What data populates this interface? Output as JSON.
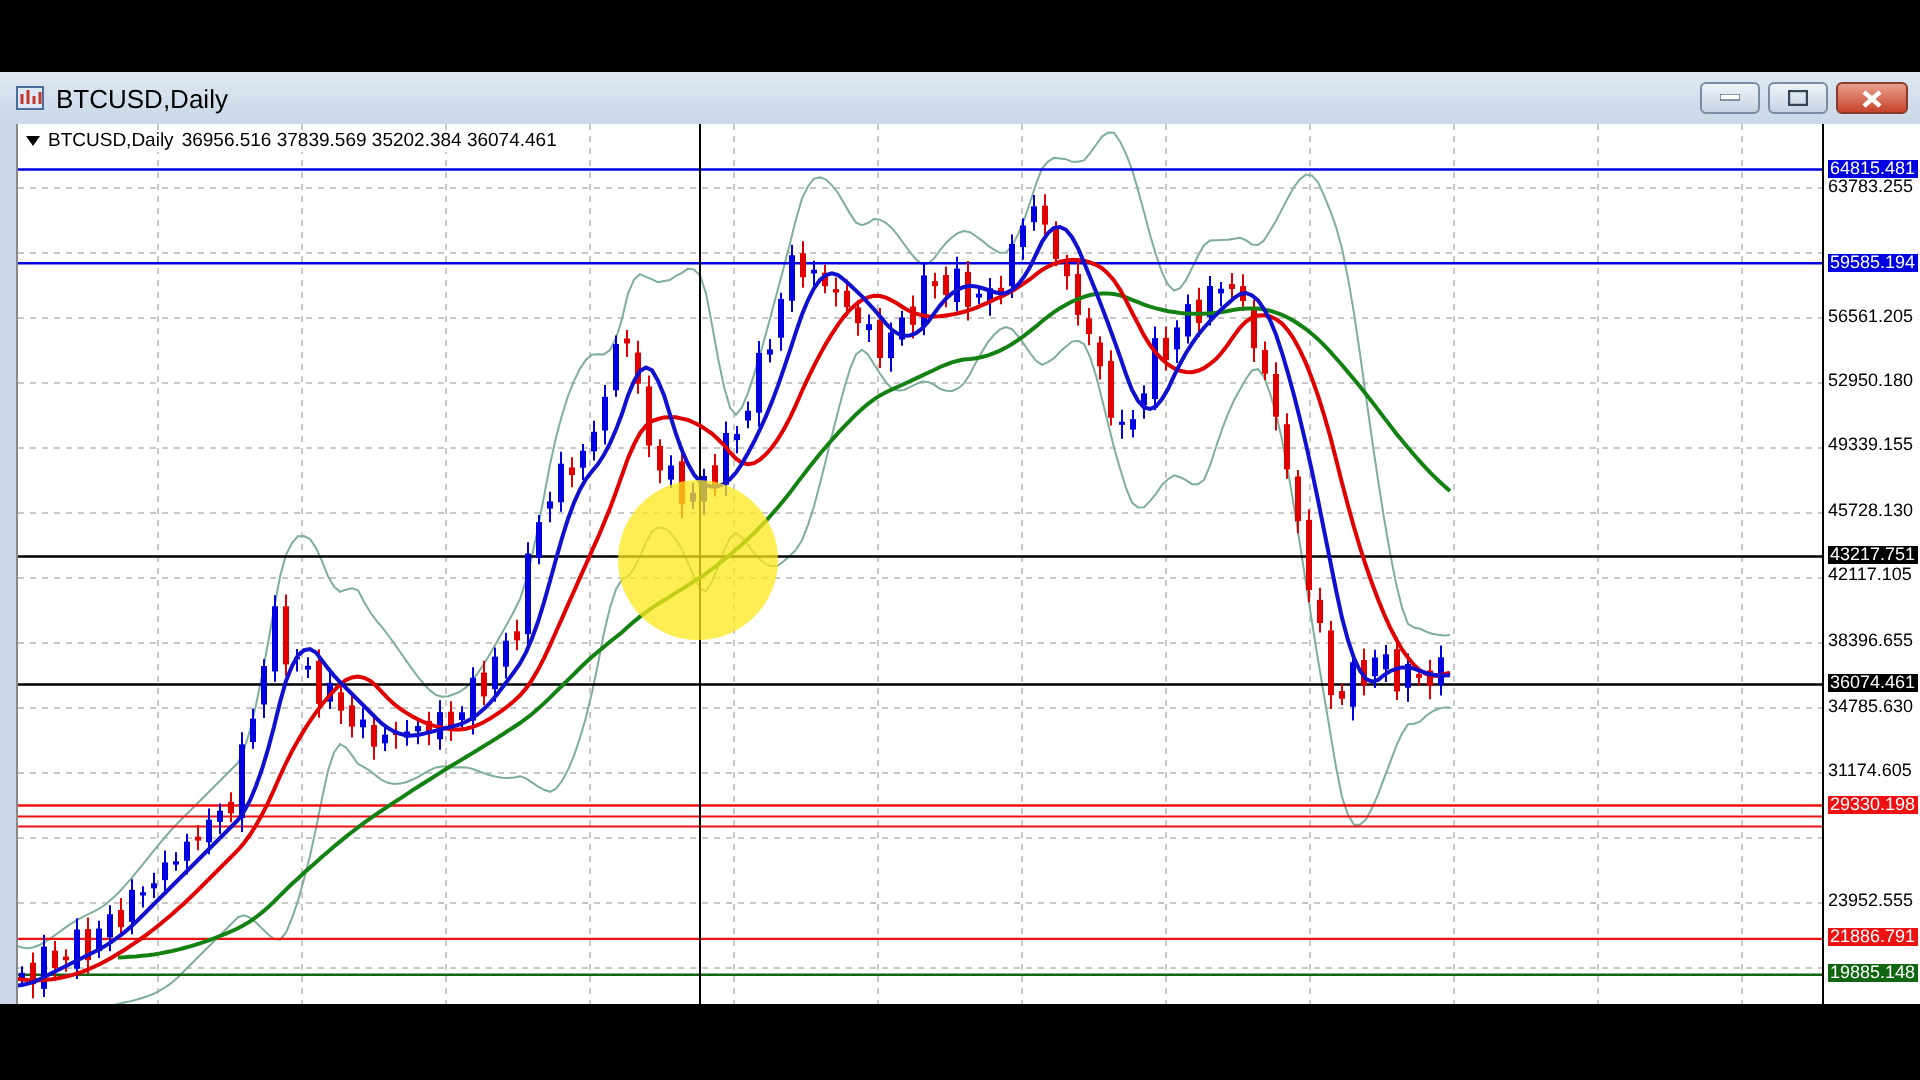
{
  "window": {
    "title": "BTCUSD,Daily"
  },
  "chart": {
    "symbol": "BTCUSD,Daily",
    "ohlc": "36956.516 37839.569 35202.384 36074.461",
    "price_ticks": [
      "63783.255",
      "56561.205",
      "52950.180",
      "49339.155",
      "45728.130",
      "42117.105",
      "38396.655",
      "34785.630",
      "31174.605",
      "23952.555"
    ],
    "levels": [
      {
        "label": "64815.481",
        "color": "#0000e0"
      },
      {
        "label": "59585.194",
        "color": "#0000e0"
      },
      {
        "label": "43217.751",
        "color": "#000000"
      },
      {
        "label": "36074.461",
        "color": "#000000"
      },
      {
        "label": "29330.198",
        "color": "#ee1111"
      },
      {
        "label": "21886.791",
        "color": "#ee1111"
      },
      {
        "label": "19885.148",
        "color": "#116611"
      }
    ]
  }
}
